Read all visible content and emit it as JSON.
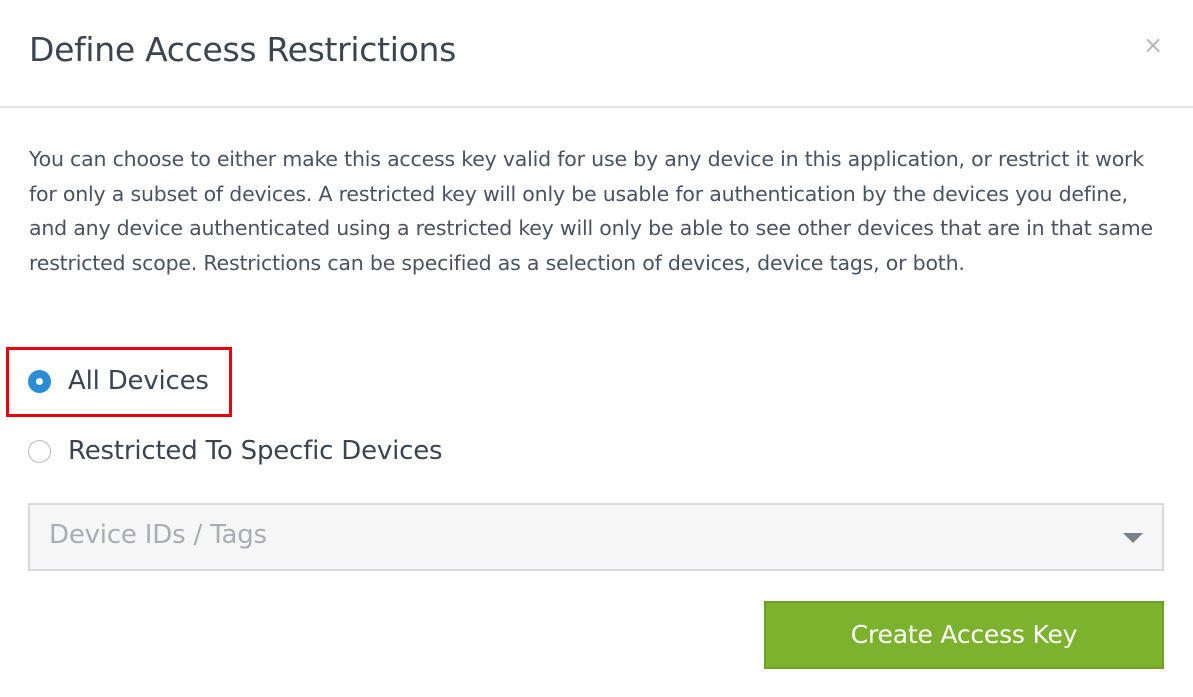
{
  "dialog": {
    "title": "Define Access Restrictions",
    "close_icon": "close-icon",
    "close_glyph": "×"
  },
  "description": "You can choose to either make this access key valid for use by any device in this application, or restrict it work for only a subset of devices. A restricted key will only be usable for authentication by the devices you define, and any device authenticated using a restricted key will only be able to see other devices that are in that same restricted scope. Restrictions can be specified as a selection of devices, device tags, or both.",
  "options": [
    {
      "label": "All Devices",
      "selected": true
    },
    {
      "label": "Restricted To Specfic Devices",
      "selected": false
    }
  ],
  "device_select": {
    "placeholder": "Device IDs / Tags",
    "icon": "chevron-down-icon"
  },
  "create_button": {
    "label": "Create Access Key"
  },
  "colors": {
    "accent_blue": "#2b8cd8",
    "button_green": "#7cb22e",
    "highlight_red": "#e8000d",
    "text_dark": "#3c4450"
  }
}
